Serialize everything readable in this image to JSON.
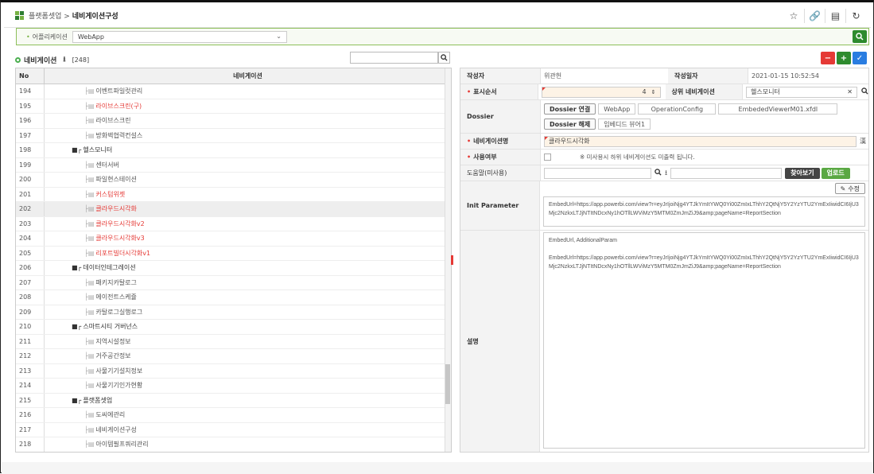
{
  "header": {
    "crumb_parent": "플랫폼셋업",
    "crumb_sep": ">",
    "crumb_current": "네비게이션구성",
    "icons": [
      "star-icon",
      "link-icon",
      "chat-icon",
      "refresh-icon"
    ]
  },
  "appbar": {
    "label": "어플리케이션",
    "selected": "WebApp",
    "search_glyph": "🔍"
  },
  "left": {
    "title": "네비게이션",
    "count": "[248]",
    "col_no": "No",
    "col_nav": "네비게이션",
    "rows": [
      {
        "no": "194",
        "label": "이벤트파일럿관리",
        "red": false,
        "folder": false
      },
      {
        "no": "195",
        "label": "라이브스크린(구)",
        "red": true,
        "folder": false
      },
      {
        "no": "196",
        "label": "라이브스크린",
        "red": false,
        "folder": false
      },
      {
        "no": "197",
        "label": "방화벽협력컨설스",
        "red": false,
        "folder": false
      },
      {
        "no": "198",
        "label": "헬스모니터",
        "red": false,
        "folder": true
      },
      {
        "no": "199",
        "label": "센터서버",
        "red": false,
        "folder": false
      },
      {
        "no": "200",
        "label": "파일현스테이션",
        "red": false,
        "folder": false
      },
      {
        "no": "201",
        "label": "커스텀위젯",
        "red": true,
        "folder": false
      },
      {
        "no": "202",
        "label": "클라우드시각화",
        "red": true,
        "folder": false
      },
      {
        "no": "203",
        "label": "클라우드시각화v2",
        "red": true,
        "folder": false
      },
      {
        "no": "204",
        "label": "클라우드시각화v3",
        "red": true,
        "folder": false
      },
      {
        "no": "205",
        "label": "리포트빌더시각화v1",
        "red": true,
        "folder": false
      },
      {
        "no": "206",
        "label": "데이터인테그레이션",
        "red": false,
        "folder": true
      },
      {
        "no": "207",
        "label": "패키지카탈로그",
        "red": false,
        "folder": false
      },
      {
        "no": "208",
        "label": "에이전트스케쥴",
        "red": false,
        "folder": false
      },
      {
        "no": "209",
        "label": "카탈로그실행로그",
        "red": false,
        "folder": false
      },
      {
        "no": "210",
        "label": "스마트시티 거버넌스",
        "red": false,
        "folder": true
      },
      {
        "no": "211",
        "label": "지역시설정보",
        "red": false,
        "folder": false
      },
      {
        "no": "212",
        "label": "거주공간정보",
        "red": false,
        "folder": false
      },
      {
        "no": "213",
        "label": "사물기기설치정보",
        "red": false,
        "folder": false
      },
      {
        "no": "214",
        "label": "사물기기인가현황",
        "red": false,
        "folder": false
      },
      {
        "no": "215",
        "label": "플랫폼셋업",
        "red": false,
        "folder": true
      },
      {
        "no": "216",
        "label": "도씨에관리",
        "red": false,
        "folder": false
      },
      {
        "no": "217",
        "label": "네비게이션구성",
        "red": false,
        "folder": false
      },
      {
        "no": "218",
        "label": "아이템필프쿼리관리",
        "red": false,
        "folder": false
      }
    ]
  },
  "form": {
    "author_label": "작성자",
    "author": "위관헌",
    "date_label": "작성일자",
    "date": "2021-01-15 10:52:54",
    "order_label": "표시순서",
    "order": "4",
    "parent_label": "상위 네비게이션",
    "parent": "헬스모니터",
    "dossier_label": "Dossier",
    "dossier_connect": "Dossier 연결",
    "dossier_tags": [
      "WebApp",
      "OperationConfig",
      "EmbededViewerM01.xfdl"
    ],
    "dossier_release": "Dossier 해제",
    "dossier_name": "임베디드 뷰어1",
    "navname_label": "네비게이션명",
    "navname": "클라우드시각화",
    "use_label": "사용여부",
    "use_note": "※ 미사용시 하위 네비게이션도 미출력 됩니다.",
    "help_label": "도움말(미사용)",
    "browse": "찾아보기",
    "upload": "업로드",
    "init_label": "Init Parameter",
    "edit": "수정",
    "init_value": "EmbedUrl=https://app.powerbi.com/view?r=eyJrIjoiNjg4YTJkYmItYWQ0Yi00ZmIxLThhY2QtNjY5Y2YzYTU2YmExIiwidCI6IjU3Mjc2NzkxLTJjNTItNDcxNy1hOTllLWViMzY5MTM0ZmJmZiJ9&amp;pageName=ReportSection",
    "desc_label": "설명",
    "desc_line1": "EmbedUrl, AdditionalParam",
    "desc_line2": "EmbedUrl=https://app.powerbi.com/view?r=eyJrIjoiNjg4YTJkYmItYWQ0Yi00ZmIxLThhY2QtNjY5Y2YzYTU2YmExIiwidCI6IjU3Mjc2NzkxLTJjNTItNDcxNy1hOTllLWViMzY5MTM0ZmJmZiJ9&amp;pageName=ReportSection"
  },
  "colors": {
    "green": "#2e8b2e",
    "red": "#e53935",
    "blue": "#2a7de1",
    "brand": "#77b243"
  }
}
